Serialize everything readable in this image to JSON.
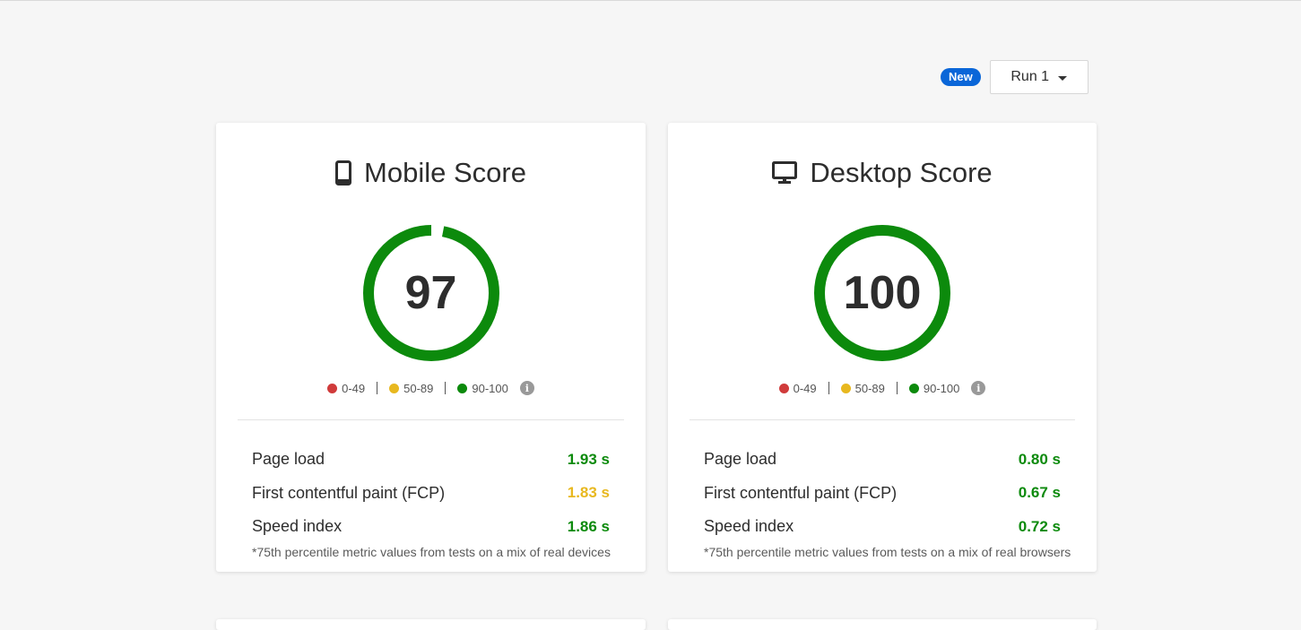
{
  "colors": {
    "poor": "#d03b3b",
    "average": "#e8b81f",
    "good": "#0c8a0c",
    "badge": "#0a66d8"
  },
  "header": {
    "badge_label": "New",
    "run_select_value": "Run 1"
  },
  "legend": {
    "poor": "0-49",
    "average": "50-89",
    "good": "90-100",
    "info_glyph": "i"
  },
  "mobile": {
    "title": "Mobile Score",
    "icon": "mobile-phone-icon",
    "score": "97",
    "score_fraction": 0.97,
    "metrics": [
      {
        "label": "Page load",
        "value": "1.93 s",
        "status": "good"
      },
      {
        "label": "First contentful paint (FCP)",
        "value": "1.83 s",
        "status": "average"
      },
      {
        "label": "Speed index",
        "value": "1.86 s",
        "status": "good"
      }
    ],
    "footnote": "*75th percentile metric values from tests on a mix of real devices"
  },
  "desktop": {
    "title": "Desktop Score",
    "icon": "desktop-monitor-icon",
    "score": "100",
    "score_fraction": 1.0,
    "metrics": [
      {
        "label": "Page load",
        "value": "0.80 s",
        "status": "good"
      },
      {
        "label": "First contentful paint (FCP)",
        "value": "0.67 s",
        "status": "good"
      },
      {
        "label": "Speed index",
        "value": "0.72 s",
        "status": "good"
      }
    ],
    "footnote": "*75th percentile metric values from tests on a mix of real browsers"
  }
}
